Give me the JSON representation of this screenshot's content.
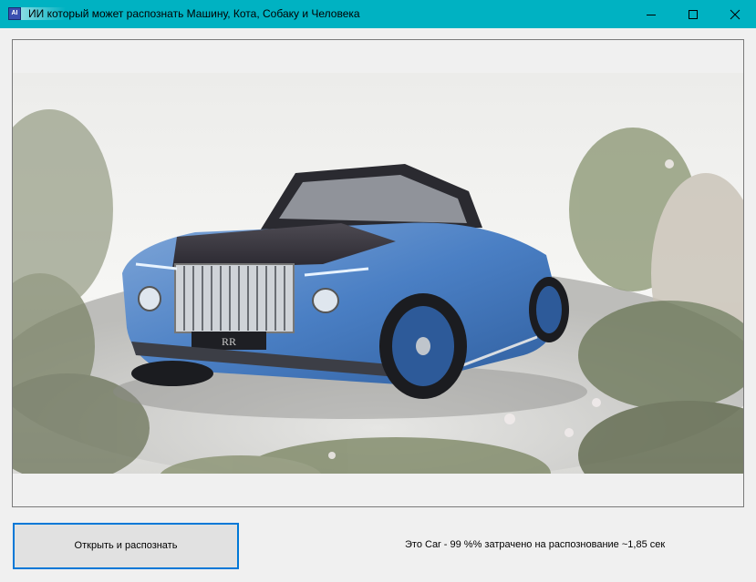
{
  "window": {
    "title": "ИИ который может распознать Машину, Кота, Собаку и Человека",
    "icon": "app-icon",
    "icon_text": "AI",
    "controls": [
      "minimize-icon",
      "maximize-icon",
      "close-icon"
    ]
  },
  "image": {
    "description_icon": "car-photo",
    "badge": "RR"
  },
  "actions": {
    "open_button_label": "Открыть и распознать"
  },
  "result": {
    "text": "Это Car  - 99 %% затрачено на распознование ~1,85 сек"
  },
  "colors": {
    "titlebar": "#00b2c2",
    "window_bg": "#f0f0f0",
    "button_border": "#0078d7",
    "button_bg": "#e1e1e1",
    "car_body": "#4a7fc4"
  }
}
